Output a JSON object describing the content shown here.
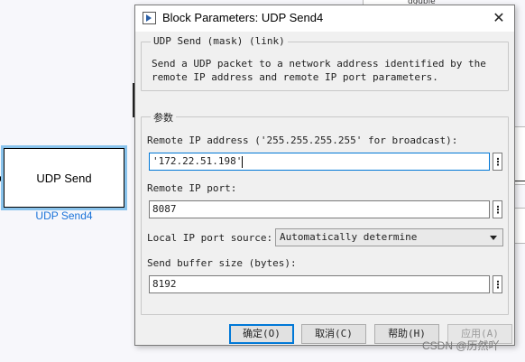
{
  "canvas": {
    "block_label": "UDP Send",
    "block_name": "UDP Send4",
    "bg_label": "double"
  },
  "dialog": {
    "title": "Block Parameters: UDP Send4",
    "mask_group_title": "UDP Send (mask) (link)",
    "description_line1": "Send a UDP packet to a network address identified by the",
    "description_line2": "remote IP address and remote IP port parameters.",
    "params_group_title": "参数",
    "remote_ip_label": "Remote IP address ('255.255.255.255' for broadcast):",
    "remote_ip_value": "'172.22.51.198'",
    "remote_port_label": "Remote IP port:",
    "remote_port_value": "8087",
    "local_port_source_label": "Local IP port source:",
    "local_port_source_value": "Automatically determine",
    "send_buffer_label": "Send buffer size (bytes):",
    "send_buffer_value": "8192",
    "ellipsis": "⋮",
    "buttons": {
      "ok": "确定(O)",
      "cancel": "取消(C)",
      "help": "帮助(H)",
      "apply": "应用(A)"
    }
  },
  "watermark": "CSDN @历然吖",
  "colors": {
    "focus_blue": "#0078d7",
    "block_highlight": "#89c3ec",
    "block_name": "#1a73d9"
  }
}
